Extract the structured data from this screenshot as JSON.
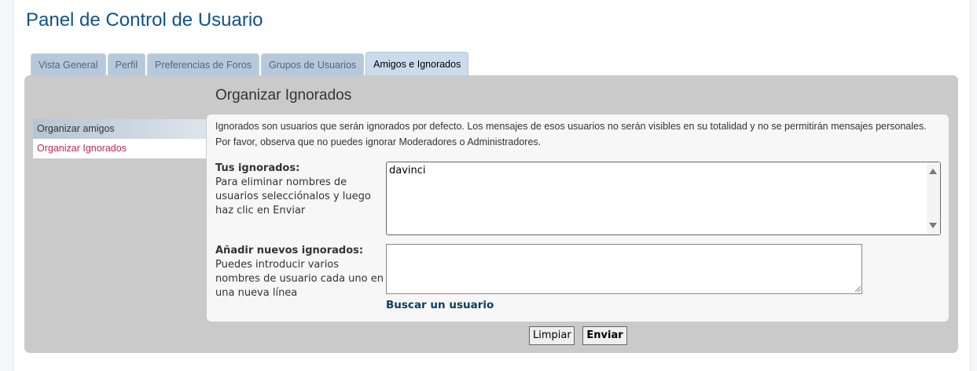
{
  "page": {
    "title": "Panel de Control de Usuario"
  },
  "tabs": [
    {
      "label": "Vista General"
    },
    {
      "label": "Perfil"
    },
    {
      "label": "Preferencias de Foros"
    },
    {
      "label": "Grupos de Usuarios"
    },
    {
      "label": "Amigos e Ignorados",
      "active": true
    }
  ],
  "sidebar": {
    "items": [
      {
        "label": "Organizar amigos"
      },
      {
        "label": "Organizar Ignorados",
        "active": true
      }
    ]
  },
  "panel": {
    "title": "Organizar Ignorados",
    "intro": "Ignorados son usuarios que serán ignorados por defecto. Los mensajes de esos usuarios no serán visibles en su totalidad y no se permitirán mensajes personales. Por favor, observa que no puedes ignorar Moderadores o Administradores."
  },
  "ignored": {
    "label": "Tus ignorados:",
    "help": "Para eliminar nombres de usuarios selecciónalos y luego haz clic en Enviar",
    "options": [
      "davinci"
    ]
  },
  "add_ignored": {
    "label": "Añadir nuevos ignorados:",
    "help": "Puedes introducir varios nombres de usuario cada uno en una nueva línea",
    "value": "",
    "search_link": "Buscar un usuario"
  },
  "buttons": {
    "reset_label": "Limpiar",
    "submit_label": "Enviar"
  },
  "colors": {
    "title": "#105289",
    "active_sidebar_text": "#bc2a4d",
    "panel_bg": "#cacaca"
  }
}
